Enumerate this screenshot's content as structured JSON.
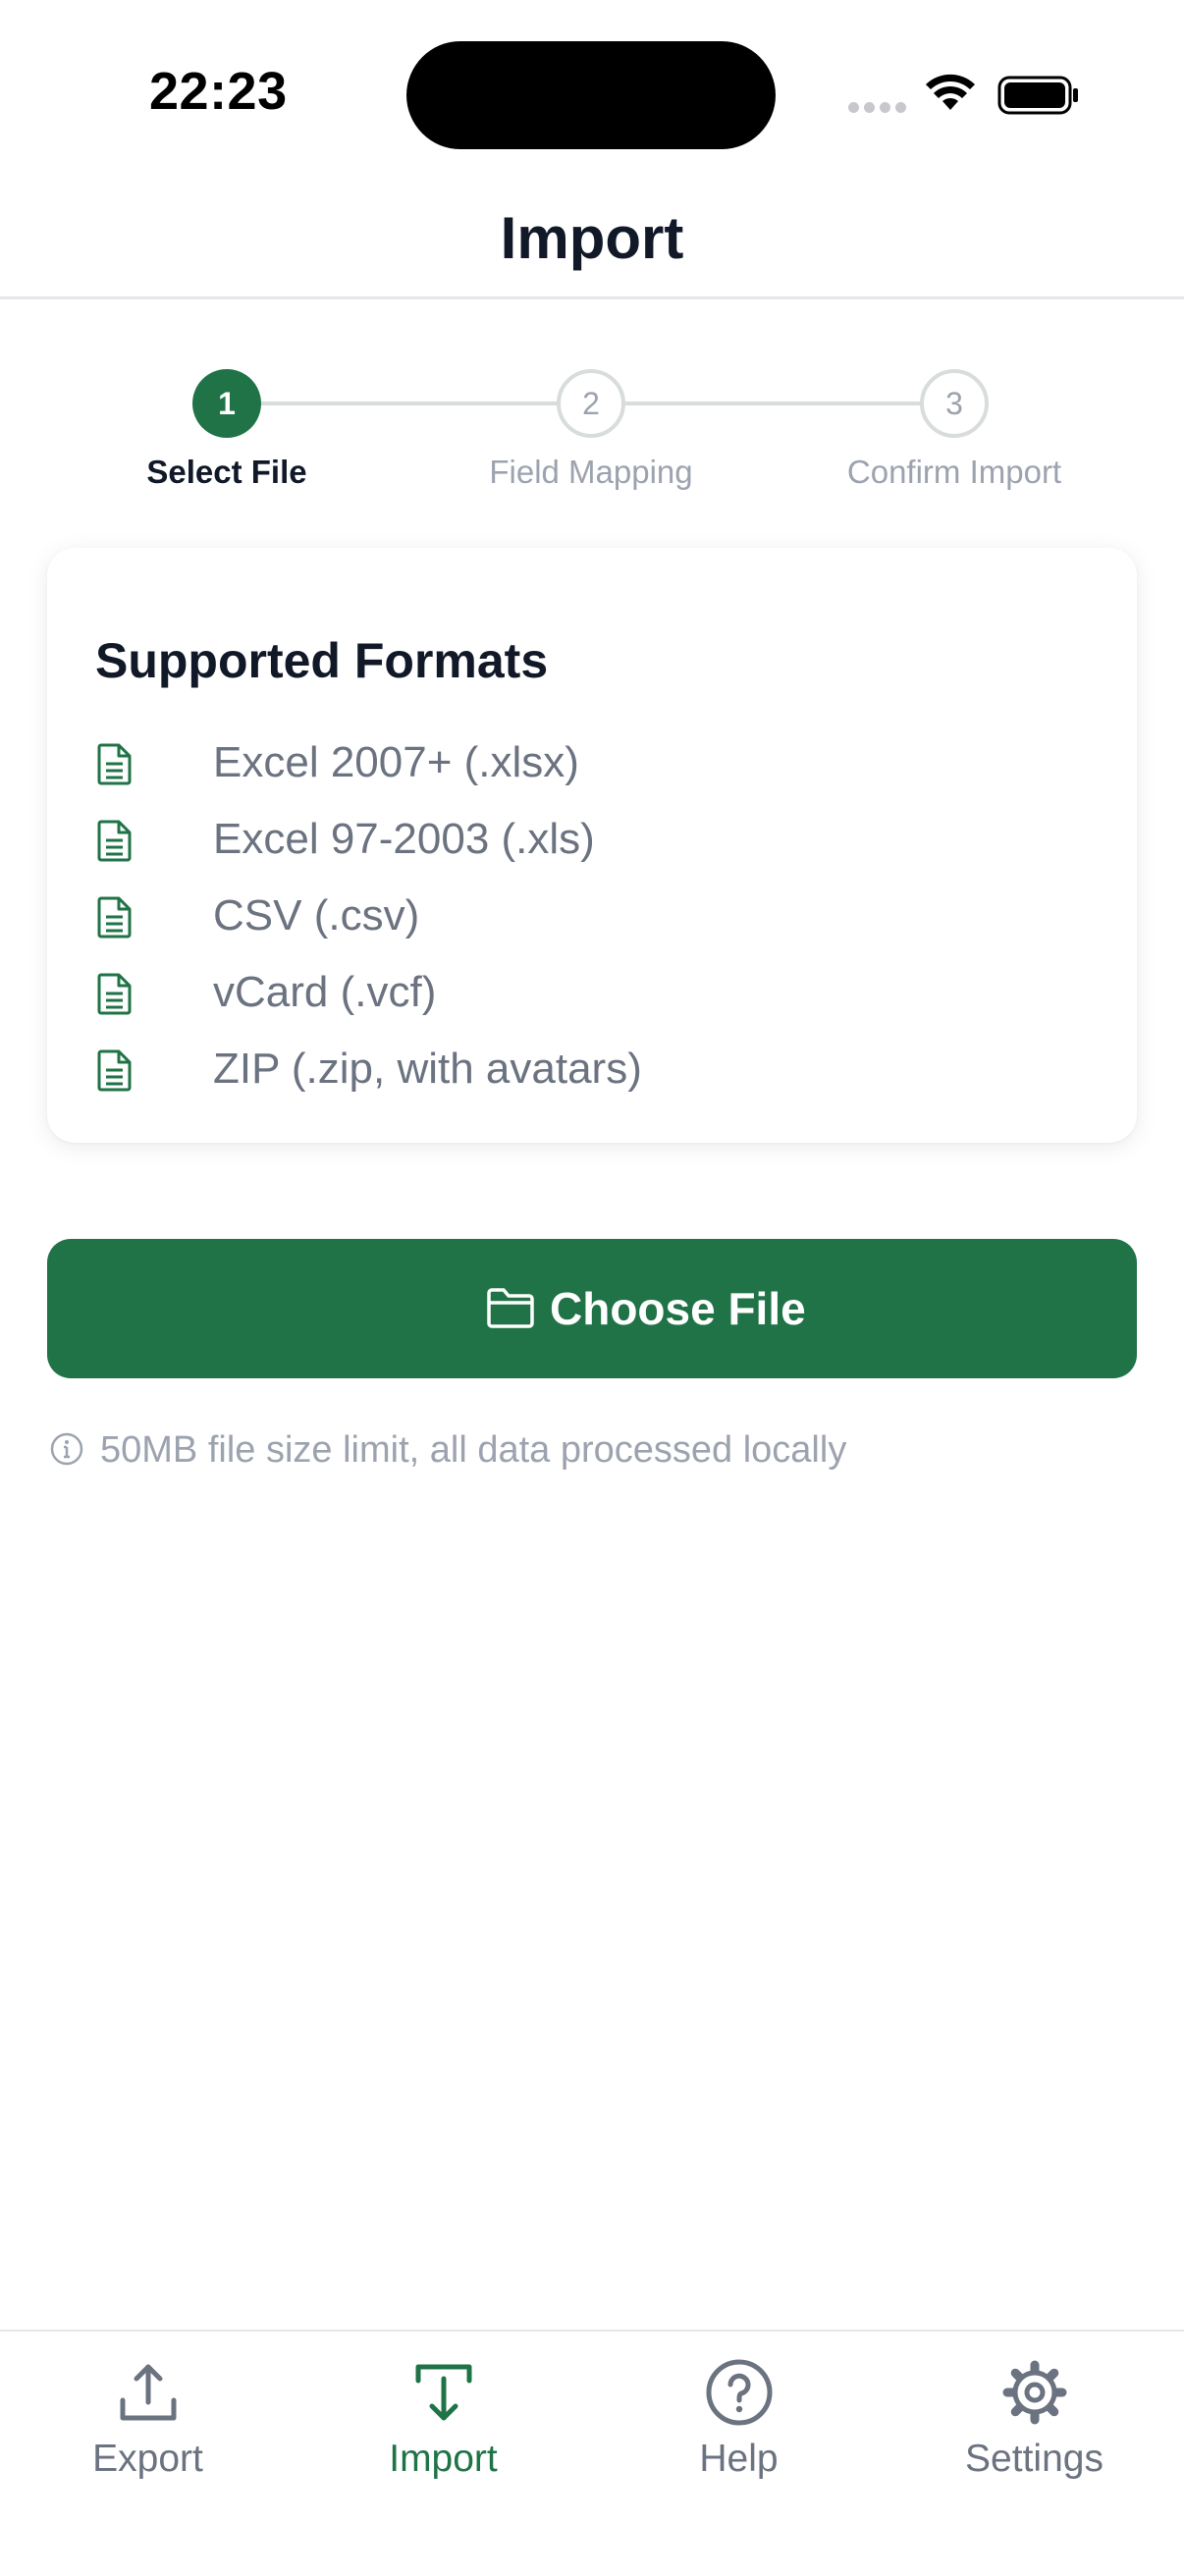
{
  "status_bar": {
    "time": "22:23"
  },
  "header": {
    "title": "Import"
  },
  "stepper": {
    "steps": [
      {
        "number": "1",
        "label": "Select File",
        "state": "active"
      },
      {
        "number": "2",
        "label": "Field Mapping",
        "state": "inactive"
      },
      {
        "number": "3",
        "label": "Confirm Import",
        "state": "inactive"
      }
    ]
  },
  "formats_card": {
    "title": "Supported Formats",
    "items": [
      {
        "label": "Excel 2007+ (.xlsx)",
        "icon": "document-icon"
      },
      {
        "label": "Excel 97-2003 (.xls)",
        "icon": "document-icon"
      },
      {
        "label": "CSV (.csv)",
        "icon": "document-icon"
      },
      {
        "label": "vCard (.vcf)",
        "icon": "document-icon"
      },
      {
        "label": "ZIP (.zip, with avatars)",
        "icon": "document-icon"
      }
    ]
  },
  "choose_button": {
    "label": "Choose File",
    "icon": "folder-icon"
  },
  "note": {
    "text": "50MB file size limit, all data processed locally",
    "icon": "info-icon"
  },
  "tab_bar": {
    "items": [
      {
        "label": "Export",
        "icon": "upload-icon",
        "active": false
      },
      {
        "label": "Import",
        "icon": "download-icon",
        "active": true
      },
      {
        "label": "Help",
        "icon": "help-circle-icon",
        "active": false
      },
      {
        "label": "Settings",
        "icon": "gear-icon",
        "active": false
      }
    ]
  },
  "colors": {
    "accent": "#1f7346",
    "muted_text": "#6b7280",
    "inactive": "#9ca3af",
    "line": "#d8dcdc"
  }
}
